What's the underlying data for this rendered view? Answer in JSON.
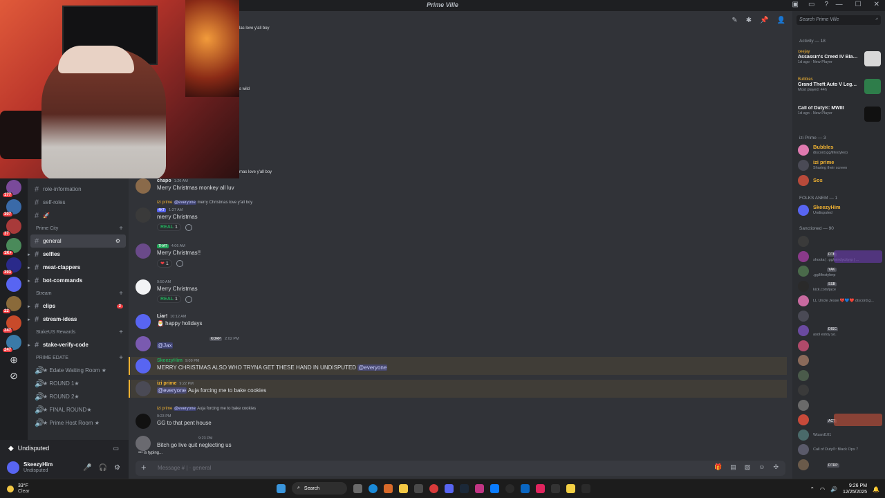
{
  "window": {
    "title": "Prime Ville"
  },
  "topbar_icons": [
    "pin-icon",
    "threads-icon",
    "mute-icon",
    "members-icon"
  ],
  "sidebar": {
    "channels_top": [
      {
        "label": "role-information"
      },
      {
        "label": "self-roles"
      },
      {
        "label": "🚀"
      }
    ],
    "cat_primecity": "Prime City",
    "channels_primecity": [
      {
        "label": "general"
      },
      {
        "label": "selfies"
      },
      {
        "label": "meat-clappers"
      },
      {
        "label": "bot-commands"
      }
    ],
    "cat_stream": "Stream",
    "channels_stream": [
      {
        "label": "clips",
        "count": "2"
      },
      {
        "label": "stream-ideas"
      }
    ],
    "cat_stake": "StakeUS Rewards",
    "stake_channel": "stake-verify-code",
    "cat_prime": "PRIME EDATE",
    "voice_channels": [
      {
        "label": "★ Edate Waiting Room ★"
      },
      {
        "label": "★ ROUND 1★"
      },
      {
        "label": "★ ROUND 2★"
      },
      {
        "label": "★ FINAL ROUND★"
      },
      {
        "label": "★ Prime Host Room ★"
      }
    ]
  },
  "rail_badges": [
    "177",
    "307",
    "37",
    "1K+",
    "393",
    "22",
    "247",
    "247"
  ],
  "voice_panel": {
    "label": "Undisputed"
  },
  "user_panel": {
    "name": "SkeezyHim",
    "status": "Undisputed"
  },
  "chat": {
    "fragments": [
      "las love y'all boy",
      "s wild",
      "mas love y'all boy"
    ],
    "messages": [
      {
        "name": "chapo",
        "time": "1:26 AM",
        "body": "Merry Christmas monkey all luv"
      },
      {
        "reply_name": "izi prime",
        "reply_mention": "@everyone",
        "reply_text": "merry Christmas love y'all boy",
        "tag": "4KT",
        "time": "1:27 AM",
        "body": "merry Christmas",
        "react_emoji": "REAL",
        "react_count": "1"
      },
      {
        "tag": "THAT",
        "time": "4:06 AM",
        "body": "Merry Christmas!!",
        "react_emoji": "❤",
        "react_count": "1"
      },
      {
        "time": "9:50 AM",
        "body": "Merry Christmas",
        "react_emoji": "REAL",
        "react_count": "1"
      },
      {
        "name": "Liar!",
        "time": "10:12 AM",
        "body": "🎅 happy holidays"
      },
      {
        "tag": "KORP",
        "time": "2:02 PM",
        "mention": "@Jax"
      },
      {
        "name": "SkeezyHim",
        "time": "9:09 PM",
        "body": "MERRY CHRISTMAS ALSO WHO TRYNA GET THESE HAND IN UNDISPUTED",
        "mention": "@everyone"
      },
      {
        "name": "izi prime",
        "time": "9:22 PM",
        "mention": "@everyone",
        "body": "Auja forcing me to bake cookies"
      },
      {
        "reply_name": "izi prime",
        "reply_mention": "@everyone",
        "reply_text": "Auja forcing me to bake cookies",
        "time": "9:23 PM",
        "body": "GG to that pent house"
      },
      {
        "time": "9:23 PM",
        "body": "Bitch go live quit neglecting us"
      }
    ],
    "typing": "is typing...",
    "composer_placeholder": "Message # |  · general"
  },
  "members": {
    "search_placeholder": "Search Prime Ville",
    "activity_header": "Activity — 18",
    "activity": [
      {
        "who": "ceejay",
        "game": "Assassin's Creed IV Black Fl...",
        "meta": "1d ago · New Player"
      },
      {
        "who": "Bubbles",
        "game": "Grand Theft Auto V Legacy",
        "meta": "Most played: 44h"
      },
      {
        "who": "",
        "game": "Call of Duty®: MWIII",
        "meta": "1d ago · New Player"
      }
    ],
    "izi_header": "izi Prime — 3",
    "izi_members": [
      {
        "name": "Bubbles",
        "status": "discord.gg/lifestylerp"
      },
      {
        "name": "izi prime",
        "status": "Sharing their screen"
      },
      {
        "name": "Sos",
        "status": ""
      }
    ],
    "folks_header": "FOLKS ANEM — 1",
    "folks_members": [
      {
        "name": "SkeezyHim",
        "status": "Undisputed"
      }
    ],
    "sanctioned_header": "Sanctioned — 90",
    "sanctioned": [
      {
        "name": "",
        "status": "",
        "tag": ""
      },
      {
        "name": "",
        "status": "shoota | .gg/windycityrp | ...",
        "tag": "DTB"
      },
      {
        "name": "",
        "status": ".gg/lifestylerp",
        "tag": "YAK"
      },
      {
        "name": "",
        "status": "kick.com/jace",
        "tag": "SSB"
      },
      {
        "name": "",
        "status": "LL Uncle Jesse 💔💙❤️ discord.g...",
        "tag": ""
      },
      {
        "name": "",
        "status": "",
        "tag": ""
      },
      {
        "name": "",
        "status": "asol estoy yo.",
        "tag": "DISC"
      },
      {
        "name": "",
        "status": "",
        "tag": ""
      },
      {
        "name": "",
        "status": "",
        "tag": ""
      },
      {
        "name": "",
        "status": "",
        "tag": ""
      },
      {
        "name": "",
        "status": "",
        "tag": ""
      },
      {
        "name": "",
        "status": "",
        "tag": ""
      },
      {
        "name": "",
        "status": "",
        "tag": "ACT"
      },
      {
        "name": "",
        "status": "Wizard101",
        "tag": ""
      },
      {
        "name": "",
        "status": "Call of Duty®: Black Ops 7",
        "tag": ""
      },
      {
        "name": "",
        "status": "",
        "tag": "DTRP"
      }
    ]
  },
  "taskbar": {
    "temp": "33°F",
    "condition": "Clear",
    "search_label": "Search",
    "time": "9:26 PM",
    "date": "12/25/2025"
  },
  "colors": {
    "accent": "#5865f2",
    "mention_bg": "#3c4270",
    "highlight": "#f0b232",
    "online": "#23a55a"
  }
}
